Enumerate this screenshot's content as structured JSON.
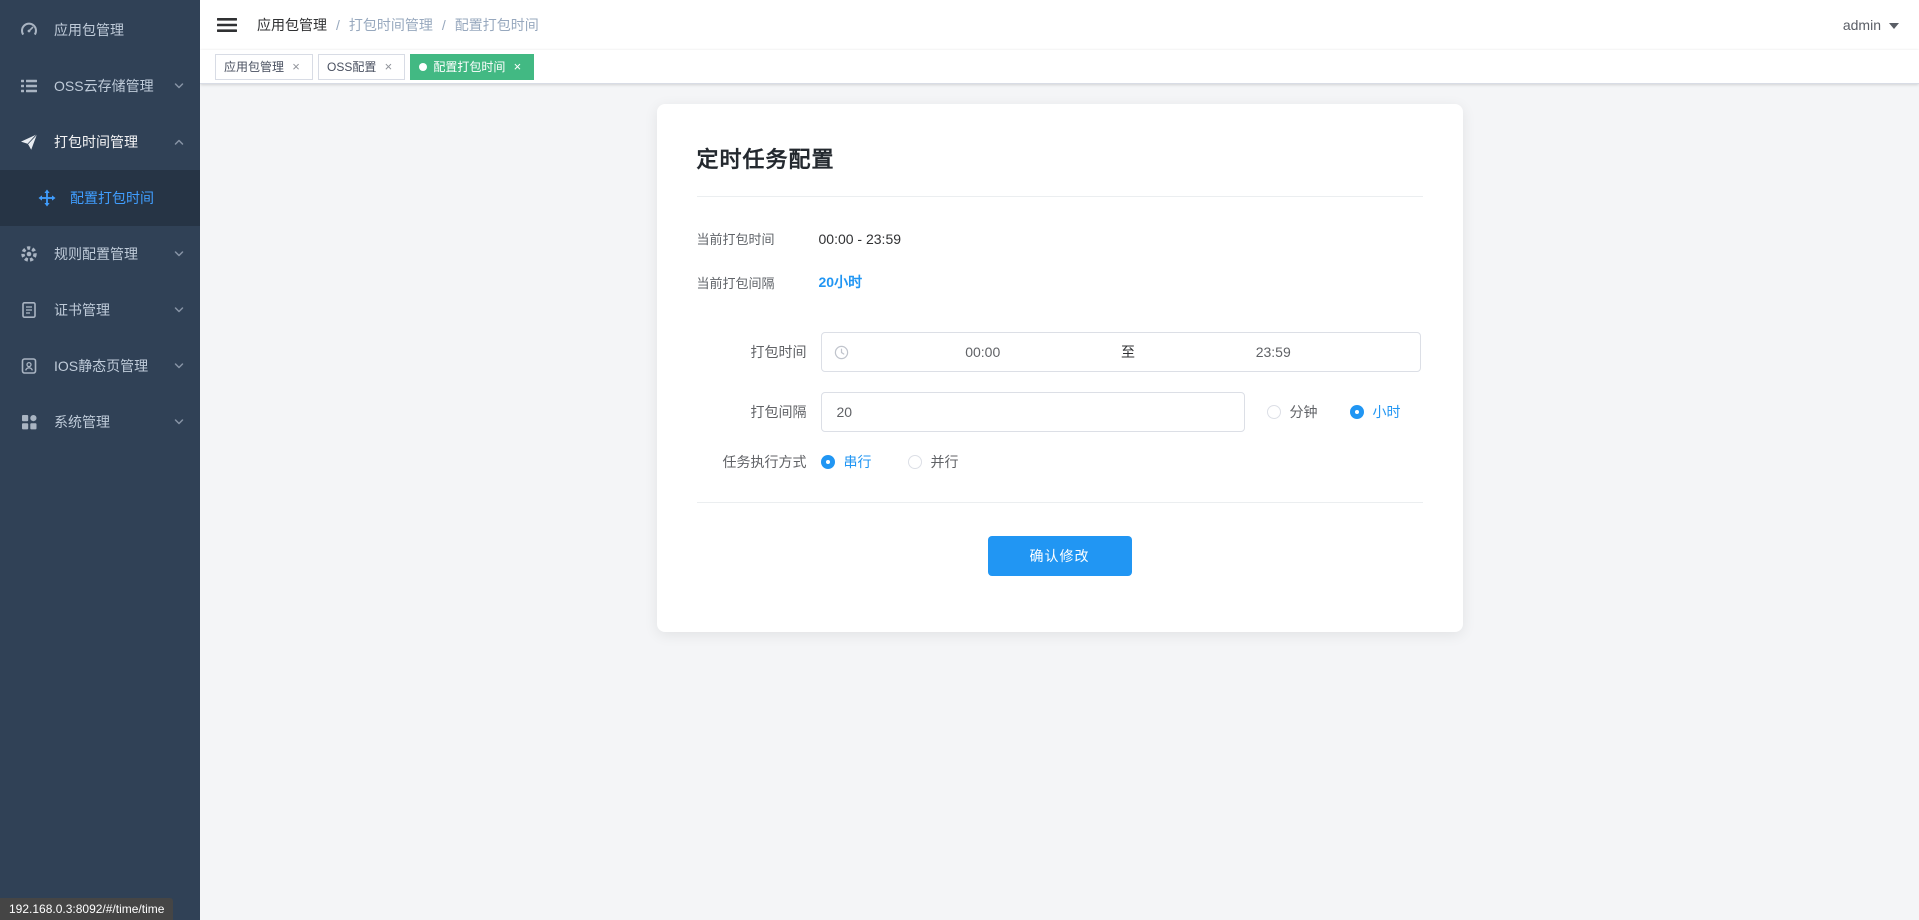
{
  "colors": {
    "sidebar_bg": "#304156",
    "submenu_active_bg": "#263445",
    "menu_active_text": "#409eff",
    "accent_blue": "#2196f3",
    "tab_active_green": "#42b983"
  },
  "sidebar": {
    "items": [
      {
        "label": "应用包管理"
      },
      {
        "label": "OSS云存储管理"
      },
      {
        "label": "打包时间管理"
      },
      {
        "label": "规则配置管理"
      },
      {
        "label": "证书管理"
      },
      {
        "label": "IOS静态页管理"
      },
      {
        "label": "系统管理"
      }
    ],
    "submenu": {
      "label": "配置打包时间"
    }
  },
  "navbar": {
    "breadcrumb": {
      "separator": "/",
      "items": [
        "应用包管理",
        "打包时间管理",
        "配置打包时间"
      ]
    },
    "user": "admin"
  },
  "tabs": {
    "close_glyph": "×",
    "items": [
      {
        "label": "应用包管理",
        "active": false
      },
      {
        "label": "OSS配置",
        "active": false
      },
      {
        "label": "配置打包时间",
        "active": true
      }
    ]
  },
  "card": {
    "title": "定时任务配置",
    "current_time": {
      "label": "当前打包时间",
      "value": "00:00 - 23:59"
    },
    "current_interval": {
      "label": "当前打包间隔",
      "value": "20小时"
    },
    "form": {
      "time": {
        "label": "打包时间",
        "start": "00:00",
        "separator": "至",
        "end": "23:59"
      },
      "interval": {
        "label": "打包间隔",
        "value": "20",
        "units": [
          {
            "label": "分钟",
            "selected": false
          },
          {
            "label": "小时",
            "selected": true
          }
        ]
      },
      "mode": {
        "label": "任务执行方式",
        "options": [
          {
            "label": "串行",
            "selected": true
          },
          {
            "label": "并行",
            "selected": false
          }
        ]
      },
      "submit": "确认修改"
    }
  },
  "status_bar": {
    "url": "192.168.0.3:8092/#/time/time"
  }
}
